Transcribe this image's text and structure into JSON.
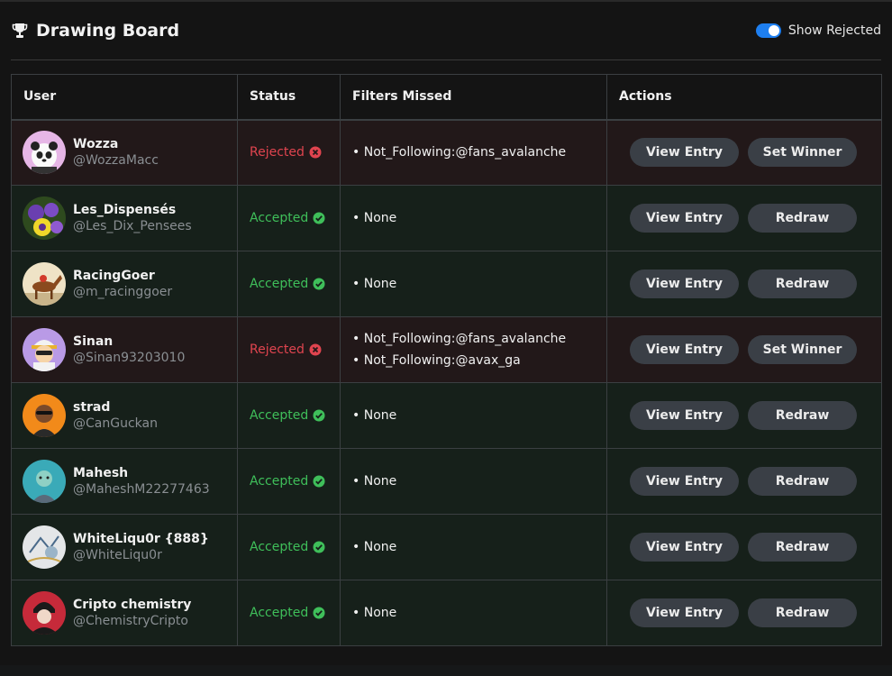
{
  "header": {
    "title": "Drawing Board",
    "toggle_label": "Show Rejected",
    "toggle_on": true
  },
  "colors": {
    "accent": "#1e7ff0",
    "rejected": "#e0444f",
    "accepted": "#3fbf5a",
    "button_bg": "#3a3f46"
  },
  "table": {
    "columns": [
      "User",
      "Status",
      "Filters Missed",
      "Actions"
    ],
    "view_label": "View Entry",
    "rows": [
      {
        "name": "Wozza",
        "handle": "@WozzaMacc",
        "status": "Rejected",
        "filters": [
          "Not_Following:@fans_avalanche"
        ],
        "action": "Set Winner",
        "avatar": "panda-avatar"
      },
      {
        "name": "Les_Dispensés",
        "handle": "@Les_Dix_Pensees",
        "status": "Accepted",
        "filters": [
          "None"
        ],
        "action": "Redraw",
        "avatar": "flowers-avatar"
      },
      {
        "name": "RacingGoer",
        "handle": "@m_racinggoer",
        "status": "Accepted",
        "filters": [
          "None"
        ],
        "action": "Redraw",
        "avatar": "horse-avatar"
      },
      {
        "name": "Sinan",
        "handle": "@Sinan93203010",
        "status": "Rejected",
        "filters": [
          "Not_Following:@fans_avalanche",
          "Not_Following:@avax_ga"
        ],
        "action": "Set Winner",
        "avatar": "cartoon-avatar"
      },
      {
        "name": "strad",
        "handle": "@CanGuckan",
        "status": "Accepted",
        "filters": [
          "None"
        ],
        "action": "Redraw",
        "avatar": "orange-avatar"
      },
      {
        "name": "Mahesh",
        "handle": "@MaheshM22277463",
        "status": "Accepted",
        "filters": [
          "None"
        ],
        "action": "Redraw",
        "avatar": "teal-avatar"
      },
      {
        "name": "WhiteLiqu0r {888}",
        "handle": "@WhiteLiqu0r",
        "status": "Accepted",
        "filters": [
          "None"
        ],
        "action": "Redraw",
        "avatar": "sketch-avatar"
      },
      {
        "name": "Cripto chemistry",
        "handle": "@ChemistryCripto",
        "status": "Accepted",
        "filters": [
          "None"
        ],
        "action": "Redraw",
        "avatar": "red-avatar"
      }
    ]
  }
}
